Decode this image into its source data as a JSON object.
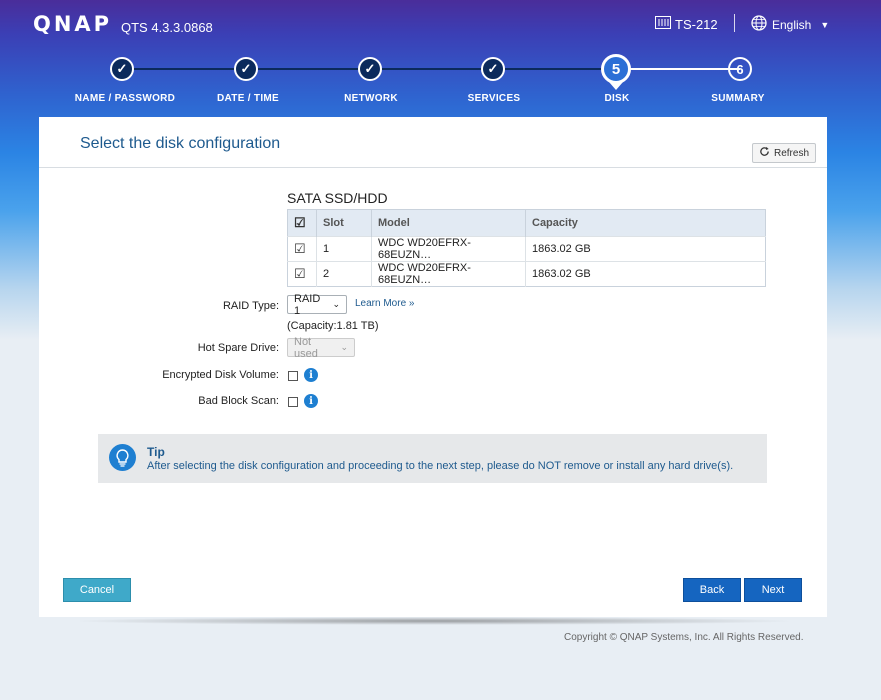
{
  "header": {
    "logo": "QNAP",
    "version": "QTS 4.3.3.0868",
    "device": "TS-212",
    "language": "English",
    "device_icon": "nas-icon",
    "language_icon": "globe-icon"
  },
  "steps": [
    {
      "number": "1",
      "label": "NAME / PASSWORD",
      "status": "done"
    },
    {
      "number": "2",
      "label": "DATE / TIME",
      "status": "done"
    },
    {
      "number": "3",
      "label": "NETWORK",
      "status": "done"
    },
    {
      "number": "4",
      "label": "SERVICES",
      "status": "done"
    },
    {
      "number": "5",
      "label": "DISK",
      "status": "active"
    },
    {
      "number": "6",
      "label": "SUMMARY",
      "status": "pending"
    }
  ],
  "panel": {
    "title": "Select the disk configuration",
    "refresh_label": "Refresh"
  },
  "disks": {
    "section_title": "SATA SSD/HDD",
    "columns": [
      "Slot",
      "Model",
      "Capacity"
    ],
    "header_check": "☑",
    "rows": [
      {
        "checked": "☑",
        "slot": "1",
        "model": "WDC WD20EFRX-68EUZN…",
        "capacity": "1863.02 GB"
      },
      {
        "checked": "☑",
        "slot": "2",
        "model": "WDC WD20EFRX-68EUZN…",
        "capacity": "1863.02 GB"
      }
    ]
  },
  "form": {
    "raid_label": "RAID Type:",
    "raid_value": "RAID 1",
    "learn_more": "Learn More »",
    "capacity_note": "(Capacity:1.81 TB)",
    "hot_spare_label": "Hot Spare Drive:",
    "hot_spare_value": "Not used",
    "encrypted_label": "Encrypted Disk Volume:",
    "bad_block_label": "Bad Block Scan:"
  },
  "tip": {
    "title": "Tip",
    "text": "After selecting the disk configuration and proceeding to the next step, please do NOT remove or install any hard drive(s)."
  },
  "buttons": {
    "cancel": "Cancel",
    "back": "Back",
    "next": "Next"
  },
  "footer": {
    "copyright": "Copyright © QNAP Systems, Inc. All Rights Reserved."
  },
  "colors": {
    "accent": "#1565c0",
    "cancel": "#3fa9c9",
    "title": "#1e5a8e"
  }
}
